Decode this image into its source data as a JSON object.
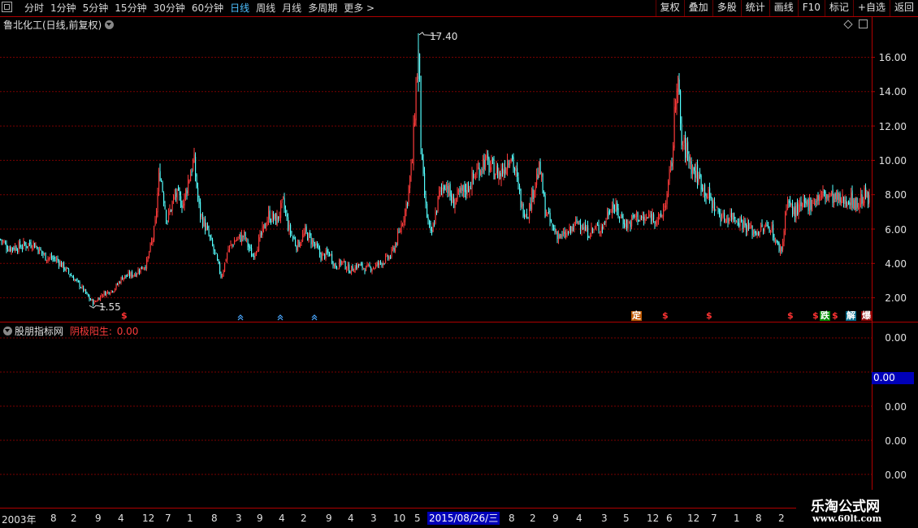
{
  "toolbar": {
    "periods": [
      "分时",
      "1分钟",
      "5分钟",
      "15分钟",
      "30分钟",
      "60分钟",
      "日线",
      "周线",
      "月线",
      "多周期",
      "更多 >"
    ],
    "active_period": "日线",
    "right_buttons": [
      "复权",
      "叠加",
      "多股",
      "统计",
      "画线",
      "F10",
      "标记",
      "+自选",
      "返回"
    ]
  },
  "main_chart": {
    "title": "鲁北化工(日线,前复权)",
    "high_label": "17.40",
    "low_label": "1.55",
    "y_ticks": [
      "16.00",
      "14.00",
      "12.00",
      "10.00",
      "8.00",
      "6.00",
      "4.00",
      "2.00"
    ]
  },
  "signals": {
    "dollar": "$",
    "ding": "定",
    "die": "跌",
    "jie": "解",
    "bao": "爆"
  },
  "sub_chart": {
    "name": "股朋指标网",
    "indicator": "阴极阳生:",
    "value": "0.00",
    "y_ticks": [
      "0.00",
      "0.00",
      "0.00",
      "0.00"
    ],
    "current_box": "0.00"
  },
  "date_axis": {
    "labels": [
      "2003年",
      "8",
      "2",
      "9",
      "4",
      "12",
      "7",
      "1",
      "8",
      "3",
      "9",
      "4",
      "2",
      "9",
      "4",
      "3",
      "10",
      "5",
      "8",
      "2",
      "9",
      "4",
      "3",
      "5",
      "12",
      "6",
      "12",
      "7",
      "1",
      "8",
      "2"
    ],
    "cursor_date": "2015/08/26/三"
  },
  "watermark": {
    "name": "乐淘公式网",
    "url": "www.60lt.com"
  },
  "colors": {
    "up": "#ff3b3b",
    "down": "#54ffff",
    "grid": "#7a0000",
    "border": "#b00000",
    "active": "#4ec0ff",
    "cursor_bg": "#0000b8"
  },
  "chart_data": {
    "type": "candlestick",
    "ylim": [
      1,
      17.5
    ],
    "y_ticks": [
      16,
      14,
      12,
      10,
      8,
      6,
      4,
      2
    ],
    "close_profile": [
      [
        0,
        5.4
      ],
      [
        10,
        4.9
      ],
      [
        25,
        5.0
      ],
      [
        40,
        5.2
      ],
      [
        55,
        4.4
      ],
      [
        70,
        4.2
      ],
      [
        85,
        3.4
      ],
      [
        100,
        2.6
      ],
      [
        110,
        1.9
      ],
      [
        115,
        1.7
      ],
      [
        125,
        2.2
      ],
      [
        140,
        2.5
      ],
      [
        150,
        3.2
      ],
      [
        165,
        3.4
      ],
      [
        180,
        4.0
      ],
      [
        190,
        6.0
      ],
      [
        196,
        9.5
      ],
      [
        205,
        6.5
      ],
      [
        215,
        8.0
      ],
      [
        225,
        7.5
      ],
      [
        232,
        9.0
      ],
      [
        238,
        10.0
      ],
      [
        245,
        7.0
      ],
      [
        255,
        5.8
      ],
      [
        265,
        4.4
      ],
      [
        272,
        3.2
      ],
      [
        280,
        4.8
      ],
      [
        290,
        5.4
      ],
      [
        300,
        5.6
      ],
      [
        310,
        4.4
      ],
      [
        320,
        5.5
      ],
      [
        330,
        6.8
      ],
      [
        340,
        6.5
      ],
      [
        348,
        7.5
      ],
      [
        355,
        6.0
      ],
      [
        365,
        5.0
      ],
      [
        375,
        5.8
      ],
      [
        385,
        5.2
      ],
      [
        395,
        4.4
      ],
      [
        405,
        4.6
      ],
      [
        412,
        3.8
      ],
      [
        420,
        4.1
      ],
      [
        430,
        3.6
      ],
      [
        440,
        3.9
      ],
      [
        450,
        3.7
      ],
      [
        460,
        3.8
      ],
      [
        470,
        4.1
      ],
      [
        480,
        4.4
      ],
      [
        490,
        5.6
      ],
      [
        500,
        7.5
      ],
      [
        507,
        10.0
      ],
      [
        511,
        14.0
      ],
      [
        515,
        16.5
      ],
      [
        518,
        10.0
      ],
      [
        524,
        7.0
      ],
      [
        530,
        5.5
      ],
      [
        540,
        8.0
      ],
      [
        548,
        8.8
      ],
      [
        556,
        7.5
      ],
      [
        566,
        8.0
      ],
      [
        576,
        8.5
      ],
      [
        585,
        9.2
      ],
      [
        595,
        10.0
      ],
      [
        605,
        9.5
      ],
      [
        615,
        9.2
      ],
      [
        622,
        9.8
      ],
      [
        628,
        10.5
      ],
      [
        635,
        9.0
      ],
      [
        642,
        7.2
      ],
      [
        650,
        7.0
      ],
      [
        658,
        8.8
      ],
      [
        664,
        9.5
      ],
      [
        670,
        7.2
      ],
      [
        680,
        6.0
      ],
      [
        690,
        5.5
      ],
      [
        700,
        5.8
      ],
      [
        712,
        6.5
      ],
      [
        722,
        5.8
      ],
      [
        732,
        6.0
      ],
      [
        742,
        6.2
      ],
      [
        752,
        7.5
      ],
      [
        762,
        6.8
      ],
      [
        772,
        6.2
      ],
      [
        782,
        6.8
      ],
      [
        792,
        6.5
      ],
      [
        802,
        6.8
      ],
      [
        812,
        6.5
      ],
      [
        820,
        7.8
      ],
      [
        827,
        10.2
      ],
      [
        833,
        15.5
      ],
      [
        838,
        11.0
      ],
      [
        845,
        10.5
      ],
      [
        852,
        9.5
      ],
      [
        862,
        8.8
      ],
      [
        870,
        8.0
      ],
      [
        880,
        7.2
      ],
      [
        890,
        6.6
      ],
      [
        900,
        6.8
      ],
      [
        910,
        6.5
      ],
      [
        918,
        6.2
      ],
      [
        928,
        5.8
      ],
      [
        938,
        6.0
      ],
      [
        948,
        6.2
      ],
      [
        956,
        5.0
      ],
      [
        962,
        4.8
      ],
      [
        968,
        7.8
      ],
      [
        975,
        7.0
      ],
      [
        985,
        7.2
      ],
      [
        995,
        7.5
      ],
      [
        1005,
        7.8
      ],
      [
        1015,
        8.0
      ],
      [
        1025,
        7.8
      ],
      [
        1035,
        7.6
      ],
      [
        1045,
        7.8
      ],
      [
        1055,
        7.4
      ],
      [
        1063,
        8.0
      ],
      [
        1070,
        7.6
      ]
    ],
    "highs": [
      [
        515,
        17.4
      ]
    ],
    "lows": [
      [
        110,
        1.55
      ]
    ]
  }
}
